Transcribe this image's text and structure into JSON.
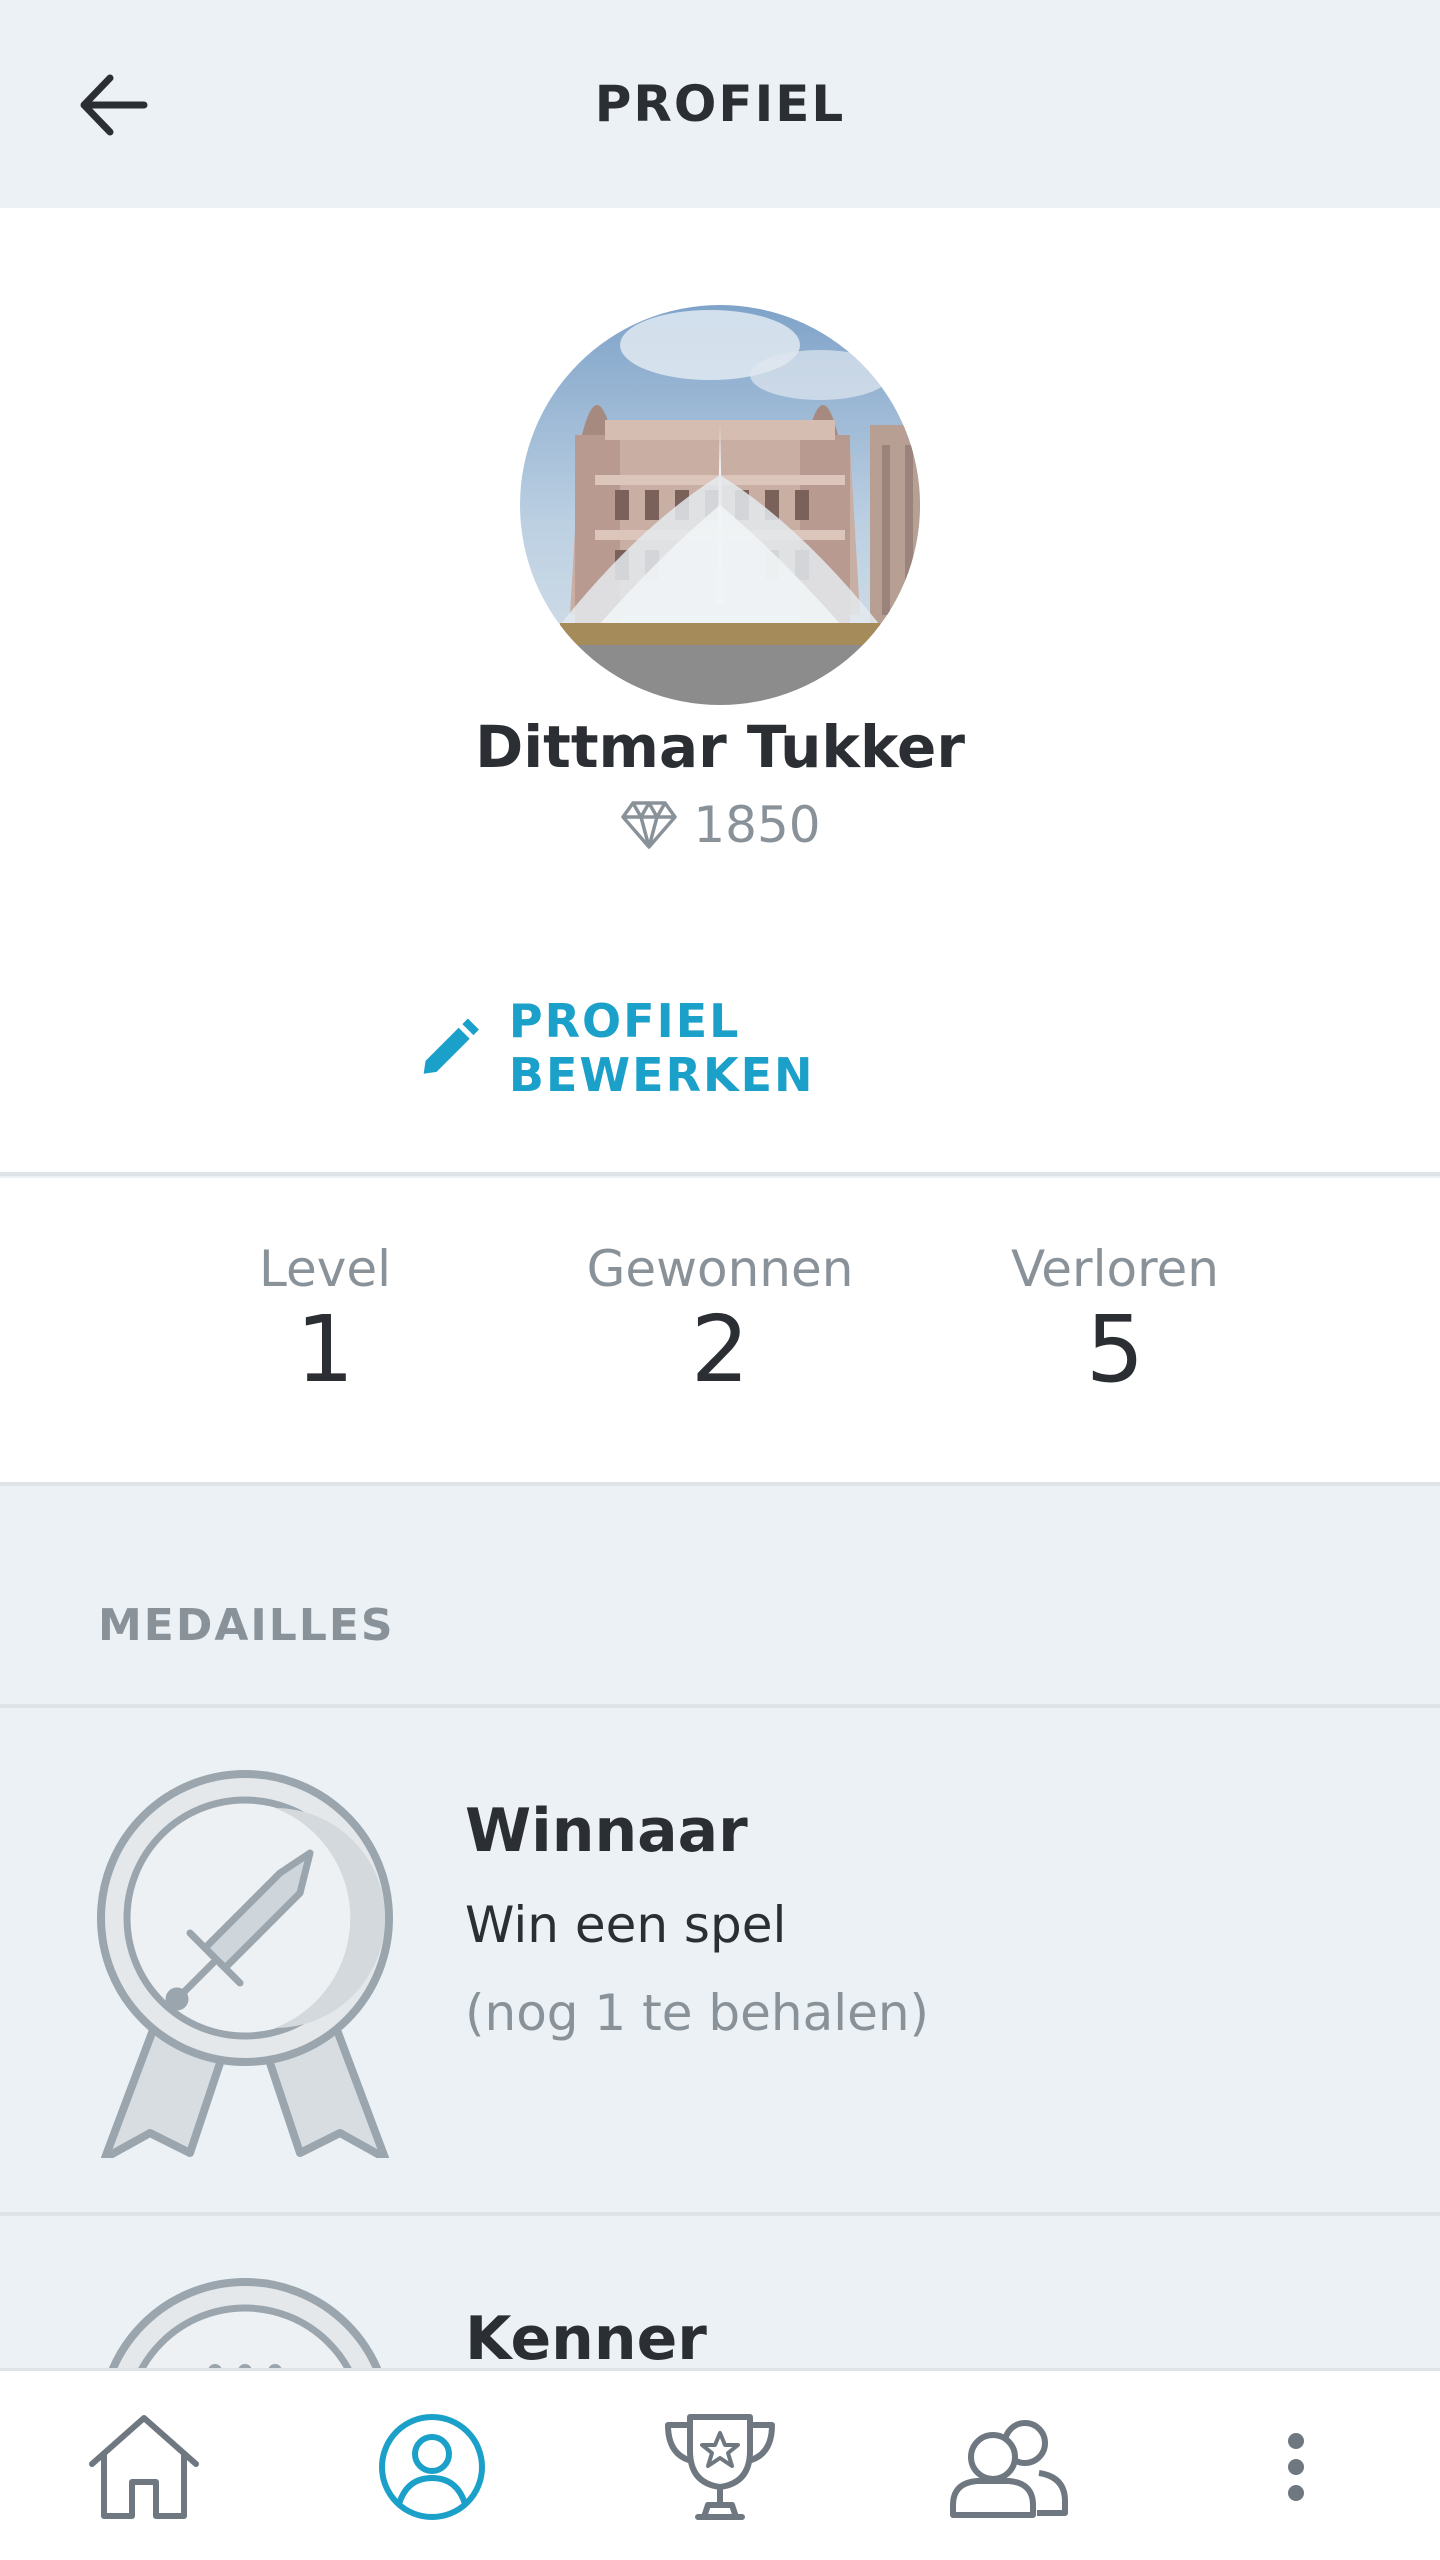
{
  "header": {
    "title": "PROFIEL",
    "back_icon": "arrow-left-icon"
  },
  "profile": {
    "name": "Dittmar Tukker",
    "points": "1850",
    "points_icon": "diamond-icon",
    "edit_label": "PROFIEL BEWERKEN",
    "edit_icon": "pencil-icon"
  },
  "stats": [
    {
      "label": "Level",
      "value": "1"
    },
    {
      "label": "Gewonnen",
      "value": "2"
    },
    {
      "label": "Verloren",
      "value": "5"
    }
  ],
  "medals": {
    "section_title": "MEDAILLES",
    "items": [
      {
        "title": "Winnaar",
        "description": "Win een spel",
        "progress": "(nog 1 te behalen)",
        "icon": "sword-medal-icon"
      },
      {
        "title": "Kenner",
        "description": "",
        "progress": "",
        "icon": "medal-icon"
      }
    ]
  },
  "bottom_nav": [
    {
      "name": "home",
      "icon": "home-icon",
      "active": false
    },
    {
      "name": "profile",
      "icon": "profile-icon",
      "active": true
    },
    {
      "name": "trophy",
      "icon": "trophy-icon",
      "active": false
    },
    {
      "name": "friends",
      "icon": "friends-icon",
      "active": false
    },
    {
      "name": "more",
      "icon": "more-vertical-icon",
      "active": false
    }
  ],
  "colors": {
    "accent": "#1aa0c9",
    "background": "#ebf1f4",
    "card": "#ffffff",
    "text": "#2b2f33",
    "muted": "#8a9299",
    "divider": "#dde3e7"
  }
}
